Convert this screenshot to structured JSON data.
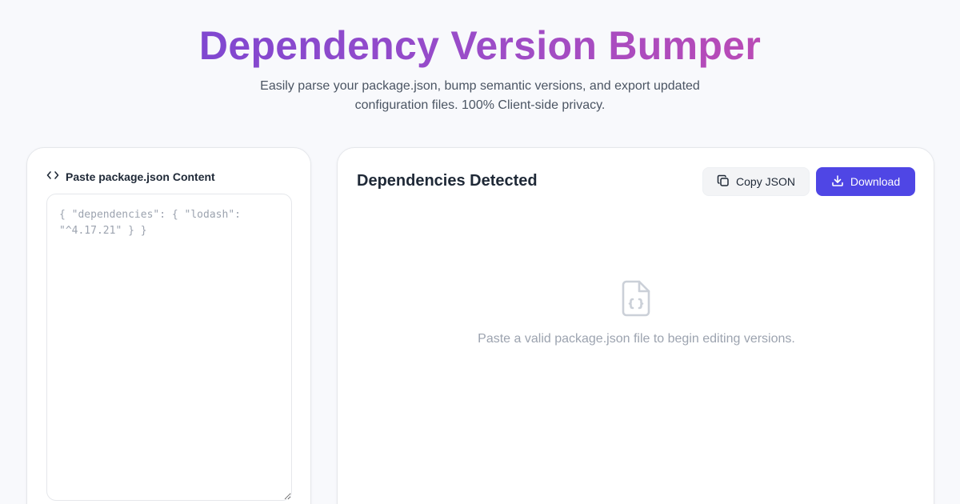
{
  "header": {
    "title": "Dependency Version Bumper",
    "subtitle": "Easily parse your package.json, bump semantic versions, and export updated configuration files. 100% Client-side privacy."
  },
  "input_panel": {
    "label": "Paste package.json Content",
    "icon": "code-icon",
    "placeholder": "{ \"dependencies\": { \"lodash\": \"^4.17.21\" } }",
    "value": ""
  },
  "dependencies_panel": {
    "title": "Dependencies Detected",
    "copy_button": {
      "label": "Copy JSON",
      "icon": "copy-icon"
    },
    "download_button": {
      "label": "Download",
      "icon": "download-icon"
    },
    "empty_state": {
      "icon": "file-json-icon",
      "message": "Paste a valid package.json file to begin editing versions."
    }
  },
  "colors": {
    "title_gradient_start": "#6d44d6",
    "title_gradient_end": "#cf4aa9",
    "accent": "#4f46e5",
    "background": "#f8f9fc",
    "muted_text": "#9ca3af"
  }
}
